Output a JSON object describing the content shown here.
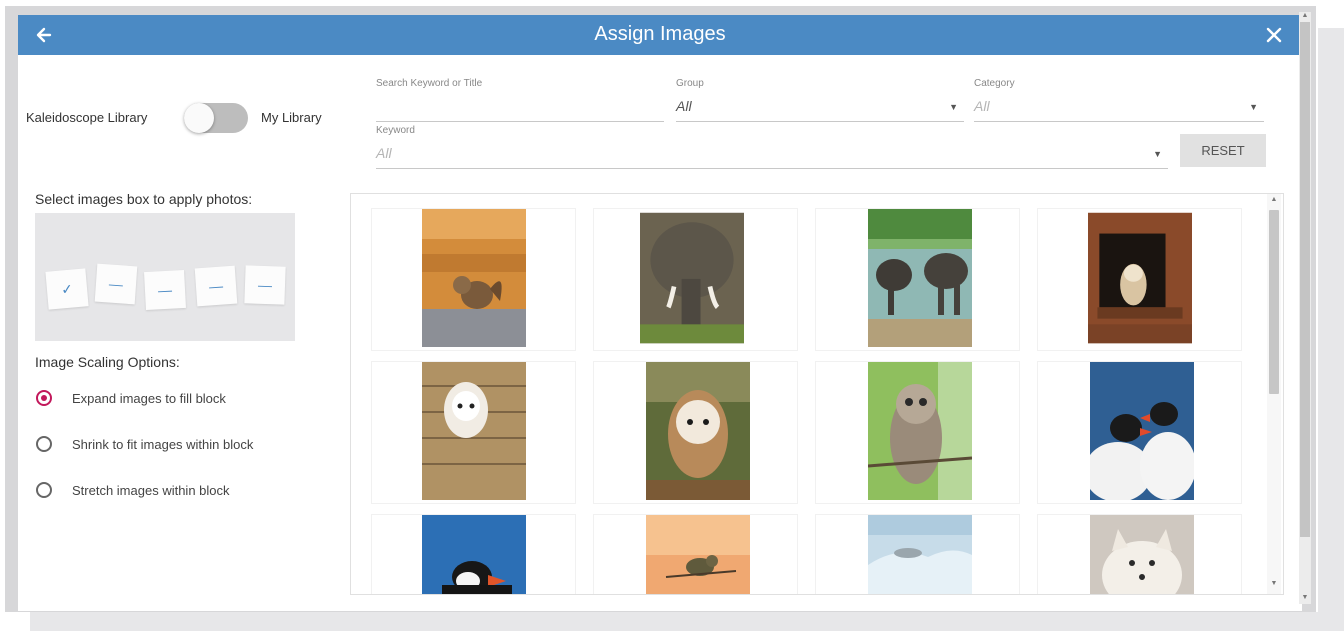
{
  "dialog": {
    "title": "Assign Images",
    "back_icon": "arrow-left-icon",
    "close_icon": "close-icon",
    "header_color": "#4b8ac4"
  },
  "library": {
    "left_label": "Kaleidoscope Library",
    "right_label": "My Library",
    "toggle_on": false
  },
  "filters": {
    "search_label": "Search Keyword or Title",
    "search_value": "",
    "group_label": "Group",
    "group_value": "All",
    "category_label": "Category",
    "category_value": "All",
    "keyword_label": "Keyword",
    "keyword_value": "All",
    "reset_label": "RESET"
  },
  "slots": {
    "label": "Select images box to apply photos:",
    "items": [
      {
        "state": "selected",
        "glyph": "✓"
      },
      {
        "state": "empty",
        "glyph": "—"
      },
      {
        "state": "empty",
        "glyph": "—"
      },
      {
        "state": "empty",
        "glyph": "—"
      },
      {
        "state": "empty",
        "glyph": "—"
      }
    ]
  },
  "scaling": {
    "title": "Image Scaling Options:",
    "options": [
      {
        "label": "Expand images to fill block",
        "checked": true
      },
      {
        "label": "Shrink to fit images within block",
        "checked": false
      },
      {
        "label": "Stretch images within block",
        "checked": false
      }
    ]
  },
  "images": [
    {
      "subject": "chipmunk"
    },
    {
      "subject": "elephant"
    },
    {
      "subject": "elephants-at-river"
    },
    {
      "subject": "owl-in-barn-window"
    },
    {
      "subject": "barn-owl-on-wall"
    },
    {
      "subject": "barn-owl"
    },
    {
      "subject": "barred-owl"
    },
    {
      "subject": "puffins"
    },
    {
      "subject": "puffin"
    },
    {
      "subject": "bird-on-branch"
    },
    {
      "subject": "seal-on-ice"
    },
    {
      "subject": "arctic-fox"
    }
  ]
}
